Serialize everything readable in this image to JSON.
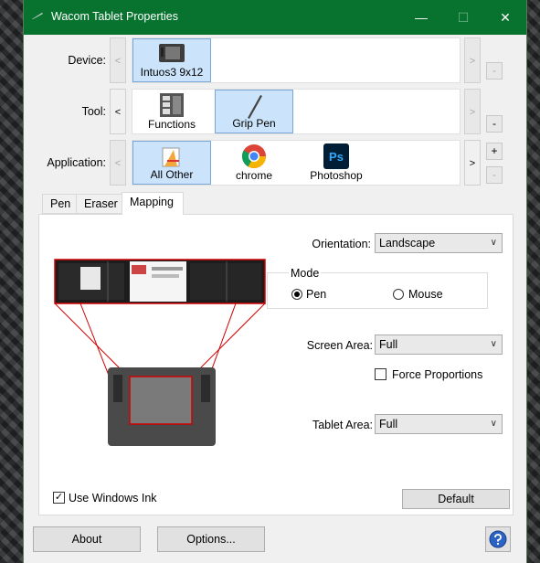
{
  "window": {
    "title": "Wacom Tablet Properties"
  },
  "device": {
    "label": "Device:",
    "items": [
      {
        "name": "Intuos3 9x12",
        "selected": true
      }
    ]
  },
  "tool": {
    "label": "Tool:",
    "items": [
      {
        "name": "Functions",
        "selected": false
      },
      {
        "name": "Grip Pen",
        "selected": true
      }
    ]
  },
  "application": {
    "label": "Application:",
    "items": [
      {
        "name": "All Other",
        "selected": true
      },
      {
        "name": "chrome",
        "selected": false
      },
      {
        "name": "Photoshop",
        "selected": false
      }
    ]
  },
  "tabs": [
    "Pen",
    "Eraser",
    "Mapping"
  ],
  "mapping": {
    "orientation_label": "Orientation:",
    "orientation_value": "Landscape",
    "mode_title": "Mode",
    "mode_pen": "Pen",
    "mode_mouse": "Mouse",
    "screen_area_label": "Screen Area:",
    "screen_area_value": "Full",
    "force_proportions": "Force Proportions",
    "tablet_area_label": "Tablet Area:",
    "tablet_area_value": "Full",
    "use_windows_ink": "Use Windows Ink",
    "default_button": "Default"
  },
  "footer": {
    "about": "About",
    "options": "Options..."
  },
  "icons": {
    "ps_text": "Ps"
  },
  "colors": {
    "titlebar": "#08732f",
    "selection": "#cce4fb",
    "mapping_line": "#e00000"
  }
}
